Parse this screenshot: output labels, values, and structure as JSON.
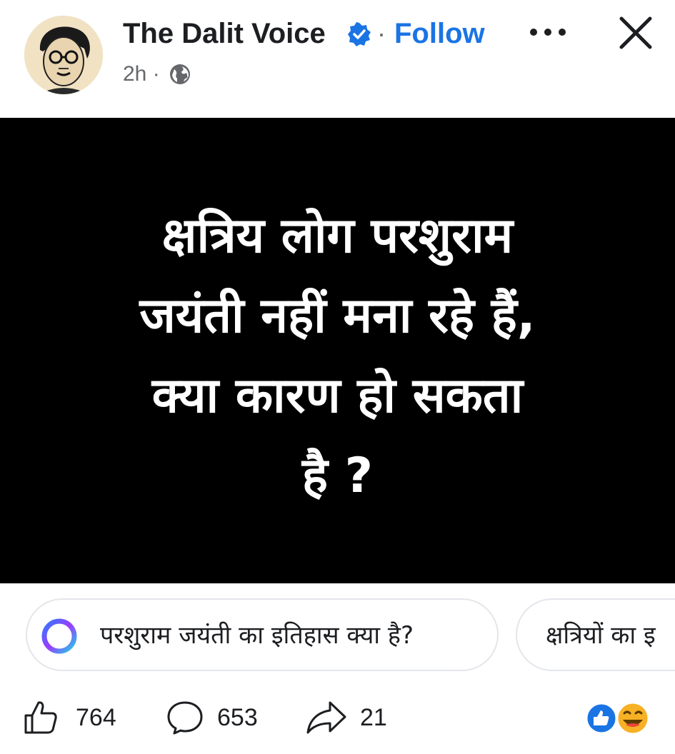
{
  "post": {
    "author": "The Dalit Voice",
    "separator": "·",
    "follow_label": "Follow",
    "time": "2h ·",
    "image_text": {
      "lines": [
        "क्षत्रिय लोग परशुराम",
        "जयंती नहीं मना रहे हैं,",
        "क्या कारण हो सकता",
        "है ?"
      ]
    }
  },
  "suggestions": [
    "परशुराम जयंती का इतिहास क्या है?",
    "क्षत्रियों का इ"
  ],
  "actions": {
    "likes": "764",
    "comments": "653",
    "shares": "21"
  },
  "icons": {
    "verified": "verified-badge-icon",
    "more": "more-options-icon",
    "close": "close-icon",
    "audience": "globe-icon",
    "ai": "meta-ai-ring-icon",
    "like": "thumbs-up-icon",
    "comment": "comment-bubble-icon",
    "share": "share-arrow-icon",
    "reactions": "reactions-icon"
  },
  "colors": {
    "follow": "#1b74e4",
    "verified": "#1b74e4",
    "image_background": "#000000",
    "image_text": "#ffffff",
    "muted": "#65676b"
  }
}
